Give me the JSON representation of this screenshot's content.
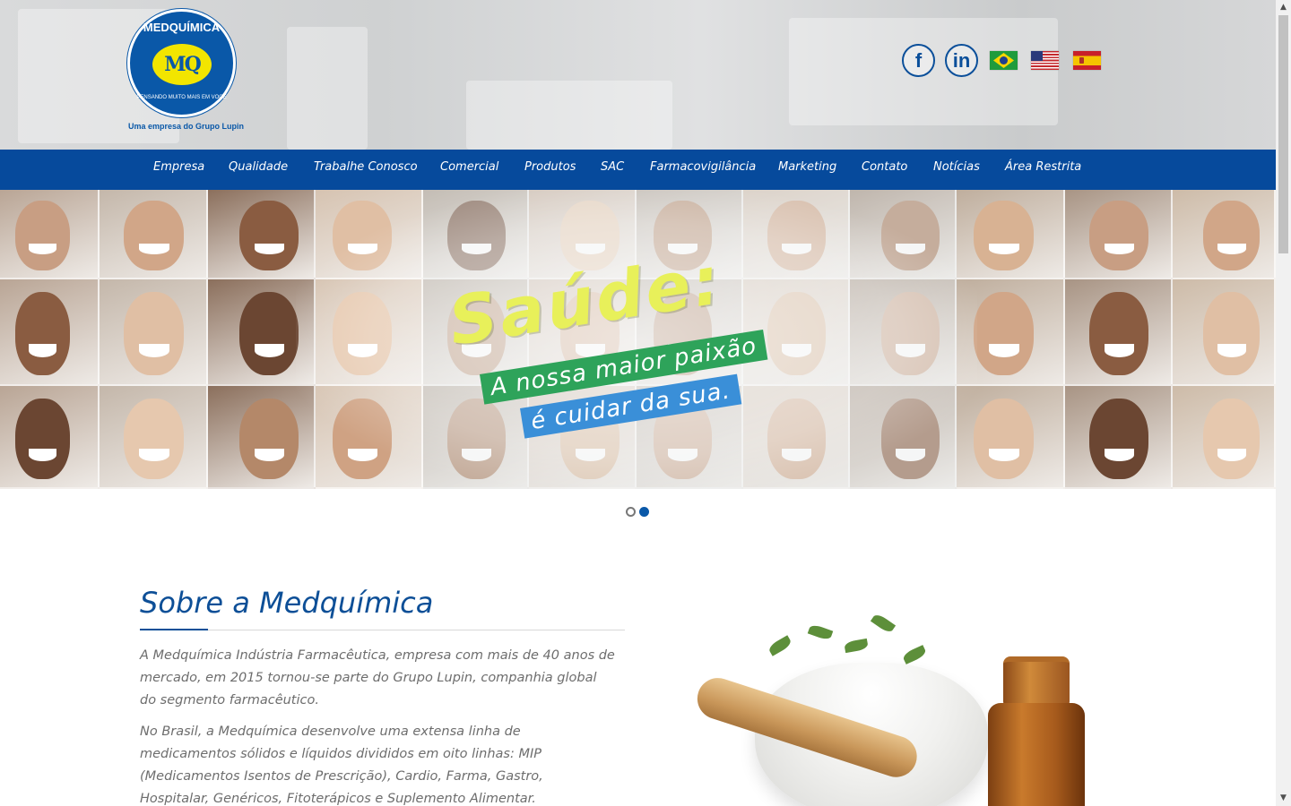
{
  "brand": {
    "name": "MEDQUÍMICA",
    "monogram": "MQ",
    "slogan": "PENSANDO MUITO MAIS EM VOCÊ",
    "tagline": "Uma empresa do Grupo Lupin",
    "color": "#0a58a8",
    "accent": "#f2e500"
  },
  "social": [
    {
      "label": "f",
      "icon": "facebook-icon"
    },
    {
      "label": "in",
      "icon": "linkedin-icon"
    }
  ],
  "languages": [
    "brazil-flag-icon",
    "usa-flag-icon",
    "spain-flag-icon"
  ],
  "nav": {
    "color": "#064a9c",
    "items": [
      {
        "label": "Empresa"
      },
      {
        "label": "Qualidade"
      },
      {
        "label": "Trabalhe Conosco"
      },
      {
        "label": "Comercial"
      },
      {
        "label": "Produtos"
      },
      {
        "label": "SAC"
      },
      {
        "label": "Farmacovigilância"
      },
      {
        "label": "Marketing"
      },
      {
        "label": "Contato"
      },
      {
        "label": "Notícias"
      },
      {
        "label": "Área Restrita"
      }
    ]
  },
  "hero": {
    "title": "Saúde:",
    "line1": "A nossa maior paixão",
    "line2": "é cuidar da sua.",
    "slides": 2,
    "active_slide": 2
  },
  "about": {
    "title": "Sobre a Medquímica",
    "paragraphs": [
      "A Medquímica Indústria Farmacêutica, empresa com mais de 40 anos de mercado, em 2015 tornou-se parte do Grupo Lupin, companhia global do segmento farmacêutico.",
      "No Brasil, a Medquímica desenvolve uma extensa linha de medicamentos sólidos e líquidos divididos em oito linhas: MIP (Medicamentos Isentos de Prescrição), Cardio, Farma, Gastro, Hospitalar, Genéricos, Fitoterápicos e Suplemento Alimentar."
    ]
  }
}
